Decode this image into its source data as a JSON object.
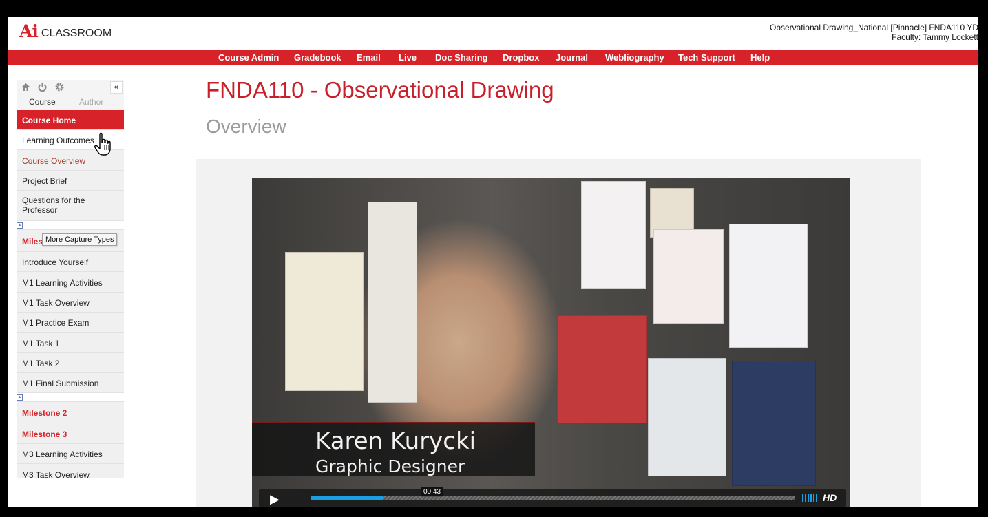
{
  "header": {
    "logo_mark": "Ai",
    "logo_text": "CLASSROOM",
    "course_line": "Observational Drawing_National [Pinnacle] FNDA110 YD",
    "faculty_line": "Faculty:  Tammy Lockett"
  },
  "nav": [
    "Course Admin",
    "Gradebook",
    "Email",
    "Live",
    "Doc Sharing",
    "Dropbox",
    "Journal",
    "Webliography",
    "Tech Support",
    "Help"
  ],
  "sidebar": {
    "icons": [
      "home-icon",
      "power-icon",
      "gear-icon"
    ],
    "collapse_label": "«",
    "tab_course": "Course",
    "tab_author": "Author",
    "items": [
      "Course Home",
      "Learning Outcomes",
      "Course Overview",
      "Project Brief",
      "Questions for the Professor",
      "Milestone 1",
      "Introduce Yourself",
      "M1 Learning Activities",
      "M1 Task Overview",
      "M1 Practice Exam",
      "M1 Task 1",
      "M1 Task 2",
      "M1 Final Submission",
      "Milestone 2",
      "Milestone 3",
      "M3 Learning Activities",
      "M3 Task Overview"
    ],
    "tooltip": "More Capture Types"
  },
  "main": {
    "title": "FNDA110 - Observational Drawing",
    "subtitle": "Overview"
  },
  "video": {
    "caption_name": "Karen Kurycki",
    "caption_role": "Graphic Designer",
    "time": "00:43",
    "progress_fraction": 0.15,
    "hd_label": "HD"
  },
  "colors": {
    "brand_red": "#d8222a",
    "title_red": "#c7202a",
    "progress_blue": "#1b9fe4"
  }
}
